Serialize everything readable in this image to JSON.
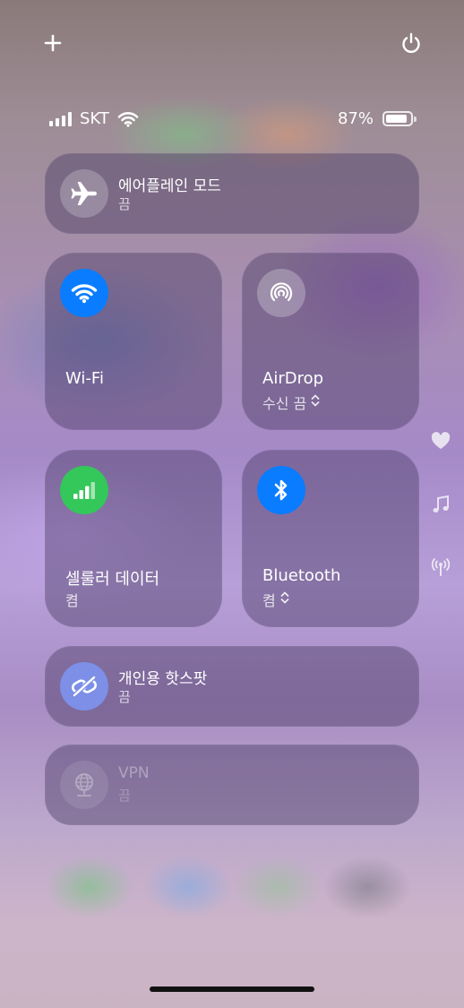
{
  "status_bar": {
    "carrier": "SKT",
    "battery_percent": "87%",
    "battery_level": 0.87
  },
  "controls": {
    "airplane": {
      "label": "에어플레인 모드",
      "status": "끔",
      "icon": "airplane-icon"
    },
    "wifi": {
      "label": "Wi-Fi",
      "icon": "wifi-icon",
      "color": "#0a7cff"
    },
    "airdrop": {
      "label": "AirDrop",
      "status": "수신 끔",
      "icon": "airdrop-icon"
    },
    "cellular": {
      "label": "셀룰러 데이터",
      "status": "켬",
      "icon": "cellular-icon",
      "color": "#34c759"
    },
    "bluetooth": {
      "label": "Bluetooth",
      "status": "켬",
      "icon": "bluetooth-icon",
      "color": "#0a7cff"
    },
    "hotspot": {
      "label": "개인용 핫스팟",
      "status": "끔",
      "icon": "hotspot-link-icon",
      "color": "#7d8fe6"
    },
    "vpn": {
      "label": "VPN",
      "status": "끔",
      "icon": "vpn-globe-icon"
    }
  },
  "side_icons": [
    "heart-icon",
    "music-note-icon",
    "antenna-icon"
  ],
  "top_icons": [
    "plus-icon",
    "power-icon"
  ]
}
